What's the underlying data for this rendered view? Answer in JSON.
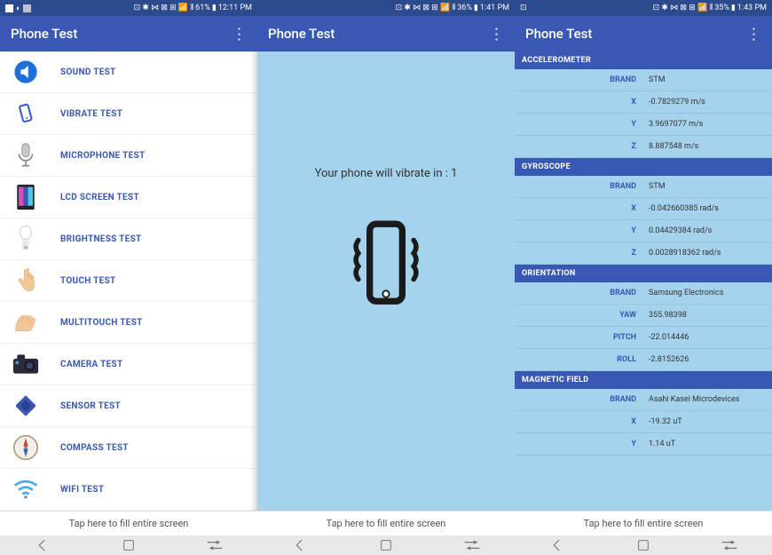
{
  "app_title": "Phone Test",
  "tap_hint": "Tap here to fill entire screen",
  "screen1": {
    "status": {
      "battery": "61%",
      "time": "12:11 PM"
    },
    "tests": [
      {
        "label": "SOUND TEST",
        "icon": "sound"
      },
      {
        "label": "VIBRATE TEST",
        "icon": "vibrate"
      },
      {
        "label": "MICROPHONE TEST",
        "icon": "mic"
      },
      {
        "label": "LCD SCREEN TEST",
        "icon": "lcd"
      },
      {
        "label": "BRIGHTNESS TEST",
        "icon": "bright"
      },
      {
        "label": "TOUCH TEST",
        "icon": "touch"
      },
      {
        "label": "MULTITOUCH TEST",
        "icon": "multitouch"
      },
      {
        "label": "CAMERA TEST",
        "icon": "camera"
      },
      {
        "label": "SENSOR TEST",
        "icon": "sensor"
      },
      {
        "label": "COMPASS TEST",
        "icon": "compass"
      },
      {
        "label": "WIFI TEST",
        "icon": "wifi"
      }
    ]
  },
  "screen2": {
    "status": {
      "battery": "36%",
      "time": "1:41 PM"
    },
    "vibrate_text": "Your phone will vibrate in : 1"
  },
  "screen3": {
    "status": {
      "battery": "35%",
      "time": "1:43 PM"
    },
    "sections": [
      {
        "name": "ACCELEROMETER",
        "rows": [
          {
            "k": "BRAND",
            "v": "STM"
          },
          {
            "k": "X",
            "v": "-0.7829279 m/s"
          },
          {
            "k": "Y",
            "v": "3.9697077 m/s"
          },
          {
            "k": "Z",
            "v": "8.887548 m/s"
          }
        ]
      },
      {
        "name": "GYROSCOPE",
        "rows": [
          {
            "k": "BRAND",
            "v": "STM"
          },
          {
            "k": "X",
            "v": "-0.042660385 rad/s"
          },
          {
            "k": "Y",
            "v": "0.04429384 rad/s"
          },
          {
            "k": "Z",
            "v": "0.0028918362 rad/s"
          }
        ]
      },
      {
        "name": "ORIENTATION",
        "rows": [
          {
            "k": "BRAND",
            "v": "Samsung Electronics"
          },
          {
            "k": "YAW",
            "v": "355.98398"
          },
          {
            "k": "PITCH",
            "v": "-22.014446"
          },
          {
            "k": "ROLL",
            "v": "-2.8152626"
          }
        ]
      },
      {
        "name": "MAGNETIC FIELD",
        "rows": [
          {
            "k": "BRAND",
            "v": "Asahi Kasei Microdevices"
          },
          {
            "k": "X",
            "v": "-19.32 uT"
          },
          {
            "k": "Y",
            "v": "1.14 uT"
          }
        ]
      }
    ]
  }
}
